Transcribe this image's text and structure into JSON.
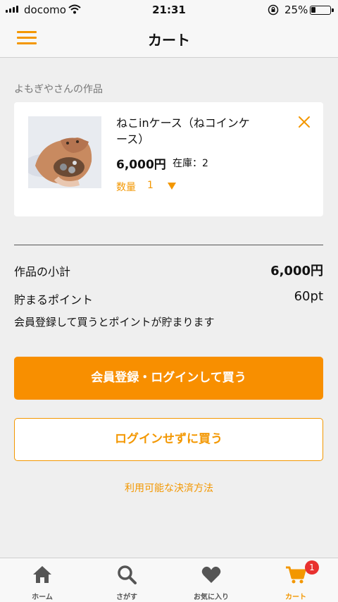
{
  "status_bar": {
    "carrier": "docomo",
    "time": "21:31",
    "battery_percent": "25%"
  },
  "header": {
    "title": "カート"
  },
  "cart": {
    "shop_name": "よもぎやさんの作品",
    "items": [
      {
        "name": "ねこinケース（ねコインケース）",
        "price": "6,000円",
        "stock": "在庫：2",
        "quantity_label": "数量",
        "quantity": "1"
      }
    ]
  },
  "summary": {
    "subtotal_label": "作品の小計",
    "subtotal_value": "6,000円",
    "points_label": "貯まるポイント",
    "points_value": "60pt",
    "note": "会員登録して買うとポイントが貯まります"
  },
  "actions": {
    "register_login_buy": "会員登録・ログインして買う",
    "guest_buy": "ログインせずに買う",
    "payment_methods": "利用可能な決済方法"
  },
  "tabbar": {
    "tabs": [
      {
        "label": "ホーム",
        "icon": "home-icon"
      },
      {
        "label": "さがす",
        "icon": "search-icon"
      },
      {
        "label": "お気に入り",
        "icon": "heart-icon"
      },
      {
        "label": "カート",
        "icon": "cart-icon",
        "badge": "1"
      }
    ]
  },
  "colors": {
    "accent": "#f39700",
    "primary_button": "#f88f00",
    "badge": "#e8312f",
    "background": "#efefef"
  }
}
